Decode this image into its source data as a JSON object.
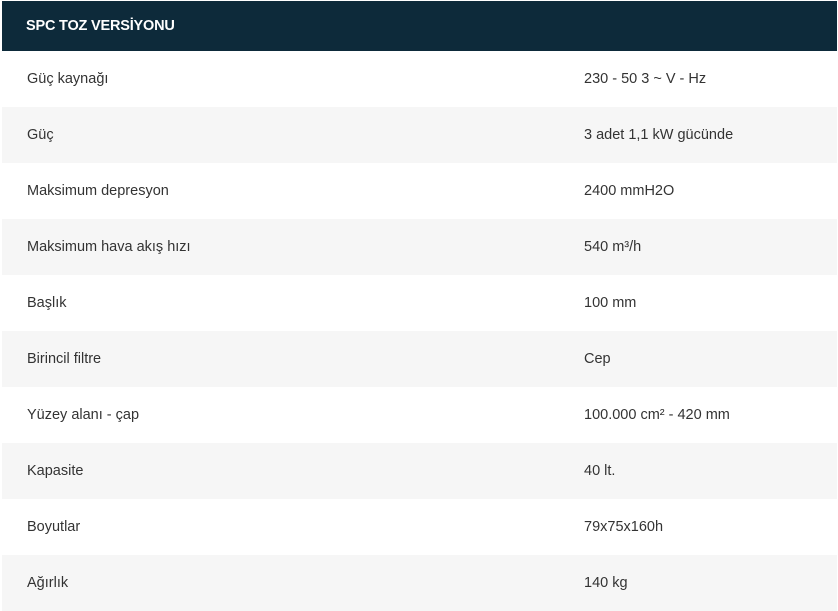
{
  "table": {
    "title": "SPC TOZ VERSİYONU",
    "rows": [
      {
        "label": "Güç kaynağı",
        "value": "230 - 50 3 ~ V - Hz"
      },
      {
        "label": "Güç",
        "value": "3 adet 1,1 kW gücünde"
      },
      {
        "label": "Maksimum depresyon",
        "value": "2400 mmH2O"
      },
      {
        "label": "Maksimum hava akış hızı",
        "value": "540 m³/h"
      },
      {
        "label": "Başlık",
        "value": "100 mm"
      },
      {
        "label": "Birincil filtre",
        "value": "Cep"
      },
      {
        "label": "Yüzey alanı - çap",
        "value": "100.000 cm² - 420 mm"
      },
      {
        "label": "Kapasite",
        "value": "40 lt."
      },
      {
        "label": "Boyutlar",
        "value": "79x75x160h"
      },
      {
        "label": "Ağırlık",
        "value": "140 kg"
      }
    ]
  }
}
